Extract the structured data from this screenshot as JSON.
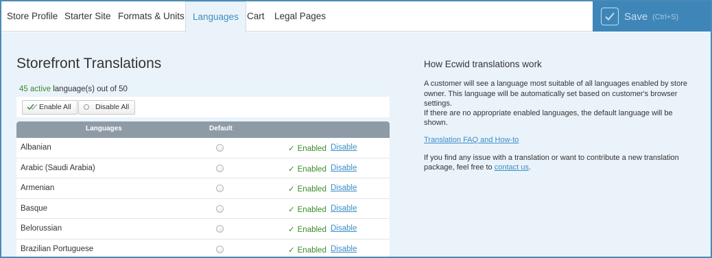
{
  "tabs": [
    {
      "label": "Store Profile",
      "active": false
    },
    {
      "label": "Starter Site",
      "active": false
    },
    {
      "label": "Formats & Units",
      "active": false
    },
    {
      "label": "Languages",
      "active": true
    },
    {
      "label": "Cart",
      "active": false
    },
    {
      "label": "Legal Pages",
      "active": false
    }
  ],
  "save": {
    "label": "Save",
    "shortcut": "(Ctrl+S)",
    "icon": "check-icon"
  },
  "page": {
    "title": "Storefront Translations",
    "active_count": "45 active",
    "count_suffix": " language(s) out of 50"
  },
  "toolbar": {
    "enable_all": "Enable All",
    "disable_all": "Disable All"
  },
  "table": {
    "headers": {
      "languages": "Languages",
      "default": "Default"
    },
    "rows": [
      {
        "language": "Albanian",
        "status": "Enabled",
        "action": "Disable"
      },
      {
        "language": "Arabic (Saudi Arabia)",
        "status": "Enabled",
        "action": "Disable"
      },
      {
        "language": "Armenian",
        "status": "Enabled",
        "action": "Disable"
      },
      {
        "language": "Basque",
        "status": "Enabled",
        "action": "Disable"
      },
      {
        "language": "Belorussian",
        "status": "Enabled",
        "action": "Disable"
      },
      {
        "language": "Brazilian Portuguese",
        "status": "Enabled",
        "action": "Disable"
      }
    ]
  },
  "info": {
    "title": "How Ecwid translations work",
    "paragraph1a": "A customer will see a language most suitable of all languages enabled by store owner. This language will be automatically set based on customer's browser settings.",
    "paragraph1b": "If there are no appropriate enabled languages, the default language will be shown.",
    "faq_link": "Translation FAQ and How-to",
    "paragraph2": "If you find any issue with a translation or want to contribute a new translation package, feel free to ",
    "contact_link": "contact us",
    "paragraph2_end": "."
  },
  "colors": {
    "accent": "#3a8dc5",
    "save_bg": "#3e86b8",
    "enabled": "#3a8a2a",
    "main_bg": "#eaf3fa",
    "table_header": "#8e9ba6"
  }
}
